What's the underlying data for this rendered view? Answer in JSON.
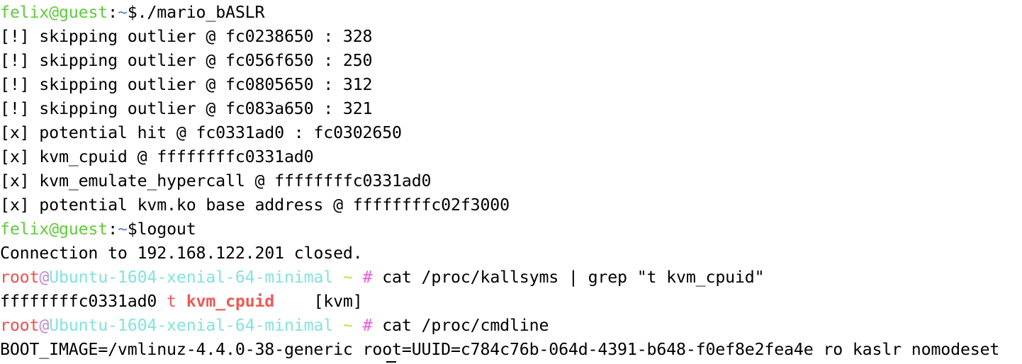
{
  "guest_prompt": {
    "user": "felix",
    "at": "@",
    "host": "guest",
    "colon": ":",
    "tilde": "~",
    "dollar": "$"
  },
  "root_prompt": {
    "user": "root",
    "at": "@",
    "host": "Ubuntu-1604-xenial-64-minimal",
    "tilde": "~",
    "hash": "#"
  },
  "lines": {
    "cmd1": "./mario_bASLR",
    "out1": "[!] skipping outlier @ fc0238650 : 328",
    "out2": "[!] skipping outlier @ fc056f650 : 250",
    "out3": "[!] skipping outlier @ fc0805650 : 312",
    "out4": "[!] skipping outlier @ fc083a650 : 321",
    "out5": "[x] potential hit @ fc0331ad0 : fc0302650",
    "out6": "[x] kvm_cpuid @ ffffffffc0331ad0",
    "out7": "[x] kvm_emulate_hypercall @ ffffffffc0331ad0",
    "out8": "[x] potential kvm.ko base address @ ffffffffc02f3000",
    "cmd2": "logout",
    "out9": "Connection to 192.168.122.201 closed.",
    "cmd3": "cat /proc/kallsyms | grep \"t kvm_cpuid\"",
    "ksym_addr": "ffffffffc0331ad0",
    "ksym_type": "t",
    "ksym_name": "kvm_cpuid",
    "ksym_module": "[kvm]",
    "cmd4": "cat /proc/cmdline",
    "out10": "BOOT_IMAGE=/vmlinuz-4.4.0-38-generic root=UUID=c784c76b-064d-4391-b648-f0ef8e2fea4e ro kaslr nomodeset"
  },
  "colors": {
    "background": "#ffffff",
    "text": "#000000",
    "guest_prompt": "#5fcc3a",
    "guest_tilde": "#5b7fd6",
    "root_user": "#ee4e4e",
    "root_at": "#c38ad8",
    "root_host": "#84e3dc",
    "root_tilde": "#d7d24a",
    "root_hash": "#ee5be0",
    "symbol_highlight": "#ec5a55"
  }
}
